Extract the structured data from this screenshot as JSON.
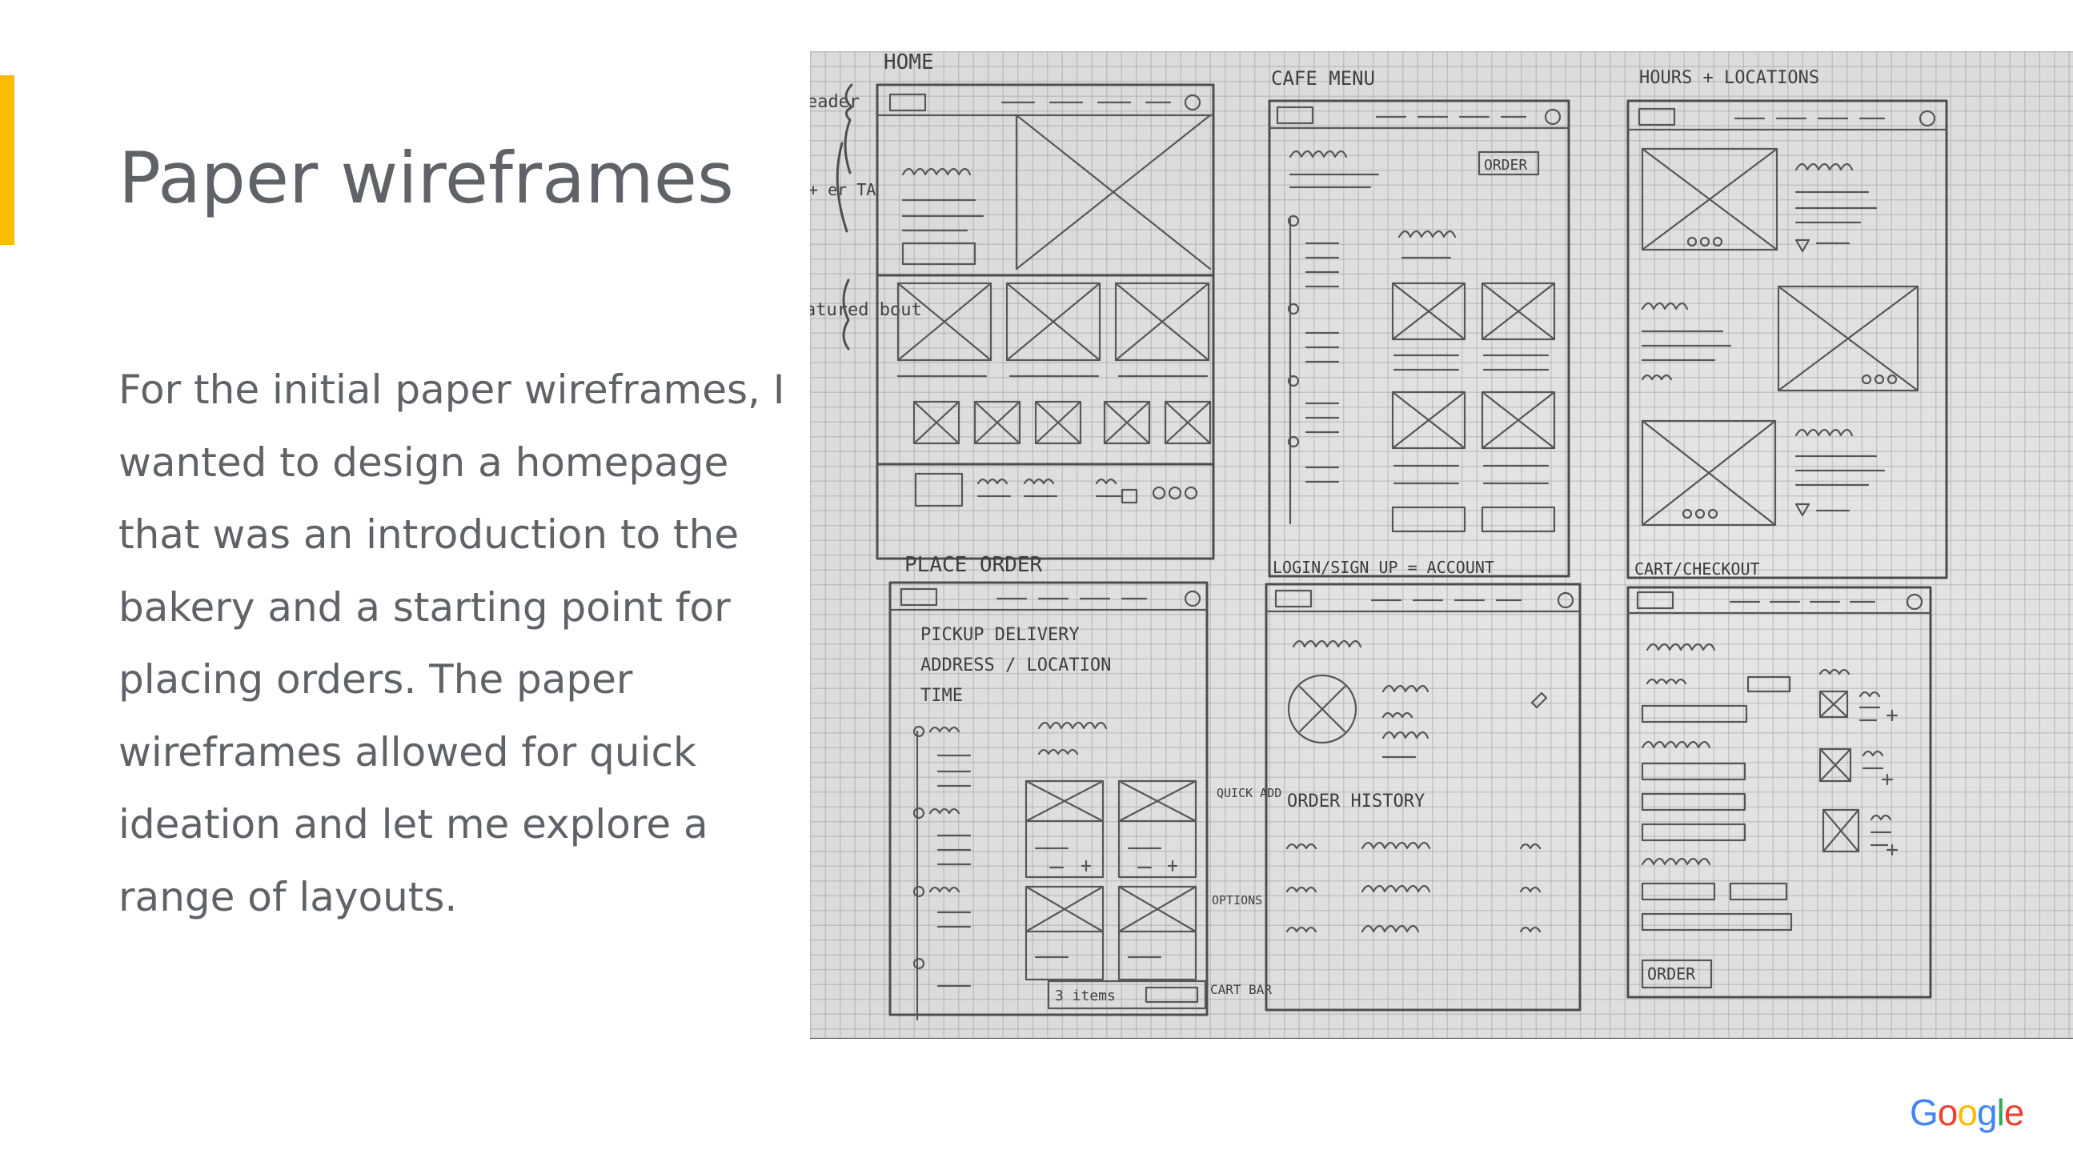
{
  "slide": {
    "title": "Paper wireframes",
    "body_lines": [
      "For the initial paper wireframes, I",
      "wanted to design a homepage",
      "that was an introduction to the",
      "bakery and a starting point for",
      "placing orders.  The paper",
      "wireframes allowed for quick",
      "ideation and let me explore a",
      "range of layouts."
    ],
    "accent_color": "#fbbc04",
    "text_color": "#5f6368"
  },
  "sketch": {
    "frame_labels": {
      "home": "HOME",
      "cafe_menu": "CAFE MENU",
      "hours": "HOURS + LOCATIONS",
      "place_order": "PLACE ORDER",
      "login": "LOGIN/SIGN UP = ACCOUNT",
      "cart": "CART/CHECKOUT"
    },
    "margin_notes": {
      "header": "eader",
      "hero": "+ er TA",
      "featured": "atured bout",
      "quick_add": "QUICK ADD",
      "options": "OPTIONS",
      "cart_bar": "CART BAR"
    },
    "place_order": {
      "pickup": "PICKUP  DELIVERY",
      "address": "ADDRESS / LOCATION",
      "time": "TIME",
      "items": "3 items"
    },
    "login": {
      "order_history": "ORDER HISTORY"
    },
    "buttons": {
      "order": "ORDER",
      "cart_order": "ORDER"
    }
  },
  "logo": {
    "letters": [
      {
        "char": "G",
        "color": "#4285f4"
      },
      {
        "char": "o",
        "color": "#ea4335"
      },
      {
        "char": "o",
        "color": "#fbbc04"
      },
      {
        "char": "g",
        "color": "#4285f4"
      },
      {
        "char": "l",
        "color": "#34a853"
      },
      {
        "char": "e",
        "color": "#ea4335"
      }
    ]
  }
}
